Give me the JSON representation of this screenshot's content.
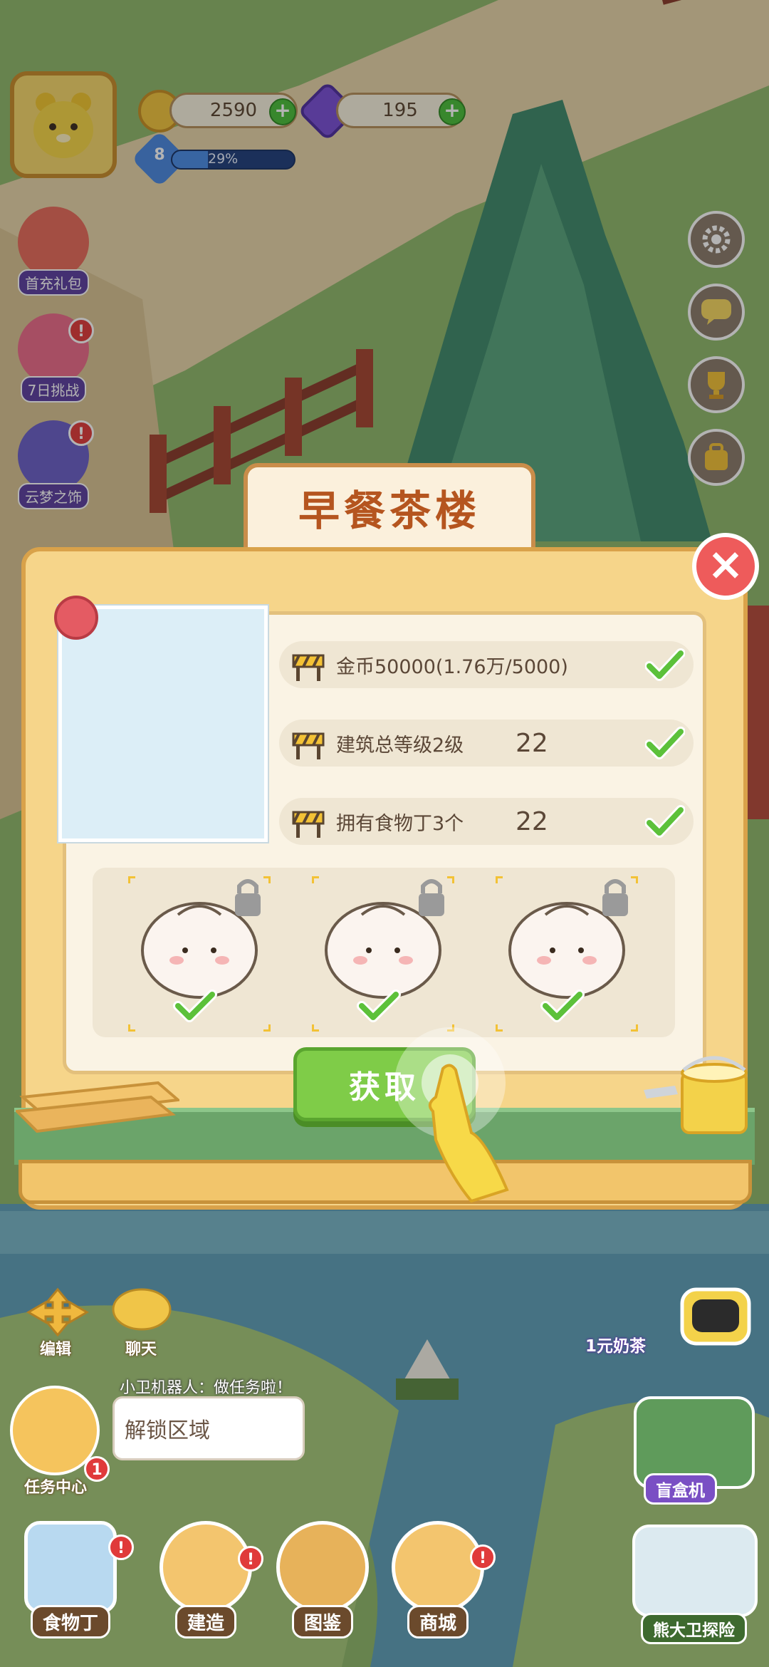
{
  "hud": {
    "coins": "2590",
    "gems": "195",
    "level": "8",
    "xp_percent_label": "29%",
    "xp_fraction": 0.29
  },
  "side_events": [
    {
      "label": "首充礼包",
      "badge": ""
    },
    {
      "label": "7日挑战",
      "badge": "!"
    },
    {
      "label": "云梦之饰",
      "badge": "!"
    }
  ],
  "modal": {
    "title": "早餐茶楼",
    "requirements": [
      {
        "label": "金币50000(1.76万/5000)",
        "value": ""
      },
      {
        "label": "建筑总等级2级",
        "value": "22"
      },
      {
        "label": "拥有食物丁3个",
        "value": "22"
      }
    ],
    "get_button": "获取"
  },
  "map_buttons": {
    "edit": "编辑",
    "chat": "聊天",
    "milk_tea": "1元奶茶",
    "blind_box": "盲盒机",
    "adventure": "熊大卫探险"
  },
  "robot": {
    "caption": "小卫机器人：做任务啦！",
    "speech": "解锁区域",
    "task_center": "任务中心",
    "task_badge": "1"
  },
  "bottom_nav": [
    {
      "label": "食物丁",
      "badge": "!"
    },
    {
      "label": "建造",
      "badge": "!"
    },
    {
      "label": "图鉴",
      "badge": ""
    },
    {
      "label": "商城",
      "badge": "!"
    }
  ]
}
